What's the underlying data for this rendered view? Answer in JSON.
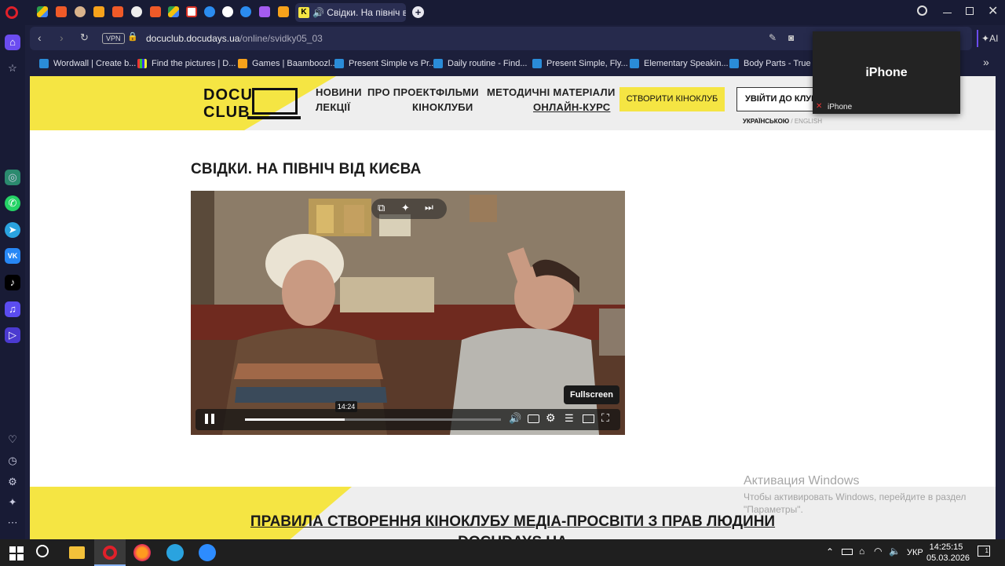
{
  "browser": {
    "active_tab_title": "Свідки. На північ від",
    "url_domain": "docuclub.docudays.ua",
    "url_path": "/online/svidky05_03",
    "vpn_label": "VPN",
    "ai_label": "AI",
    "bookmarks": [
      "Wordwall | Create b...",
      "Find the pictures | D...",
      "Games | Baamboozl...",
      "Present Simple vs Pr...",
      "Daily routine - Find...",
      "Present Simple, Fly...",
      "Elementary Speakin...",
      "Body Parts - True or..."
    ],
    "bookmarks_more": "»"
  },
  "site": {
    "logo_line1": "DOCU",
    "logo_line2": "CLUB",
    "nav": {
      "news": "НОВИНИ",
      "about": "ПРО ПРОЕКТ",
      "films": "ФІЛЬМИ",
      "methods": "МЕТОДИЧНІ МАТЕРІАЛИ",
      "lectures": "ЛЕКЦІЇ",
      "clubs": "КІНОКЛУБИ",
      "online_course": "ОНЛАЙН-КУРС"
    },
    "create_club_button": "СТВОРИТИ КІНОКЛУБ",
    "login_button": "УВІЙТИ ДО КЛУБУ",
    "lang_active": "УКРАЇНСЬКОЮ",
    "lang_separator": "/",
    "lang_other": "ENGLISH"
  },
  "page": {
    "title": "СВІДКИ. НА ПІВНІЧ ВІД КИЄВА",
    "rules_link_line1": "ПРАВИЛА СТВОРЕННЯ КІНОКЛУБУ МЕДІА-ПРОСВІТИ З ПРАВ ЛЮДИНИ",
    "rules_link_line2": "DOCUDAYS UA"
  },
  "video": {
    "timestamp_tooltip": "14:24",
    "fullscreen_tooltip": "Fullscreen",
    "progress": 0.39
  },
  "watermark": {
    "title": "Активация Windows",
    "line1": "Чтобы активировать Windows, перейдите в раздел",
    "line2": "\"Параметры\"."
  },
  "iphone_overlay": {
    "title": "iPhone",
    "label": "iPhone"
  },
  "taskbar": {
    "lang": "УКР",
    "time": "14:25:15",
    "date": "05.03.2026",
    "notif_count": "1"
  },
  "colors": {
    "accent_yellow": "#f5e543",
    "browser_bg": "#1c1f3b"
  }
}
